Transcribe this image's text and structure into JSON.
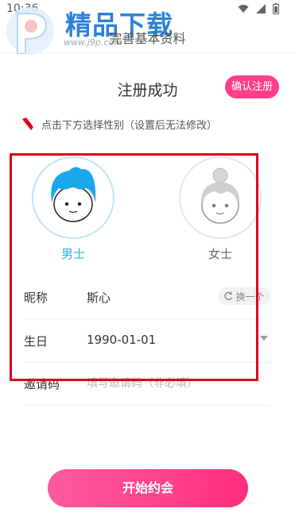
{
  "status_bar": {
    "time": "10:36"
  },
  "watermark": {
    "title": "精品下载",
    "url": "www.j9p.com"
  },
  "header": {
    "title": "完善基本资料"
  },
  "main": {
    "success_title": "注册成功",
    "confirm_button": "确认注册",
    "hint": "点击下方选择性别（设置后无法修改）",
    "genders": {
      "male": "男士",
      "female": "女士"
    },
    "fields": {
      "nickname": {
        "label": "昵称",
        "value": "斯心",
        "swap_label": "换一个"
      },
      "birthday": {
        "label": "生日",
        "value": "1990-01-01"
      },
      "invite": {
        "label": "邀请码",
        "placeholder": "填写邀请码（非必填）"
      }
    },
    "start_button": "开始约会"
  },
  "colors": {
    "accent_pink": "#ff3f88",
    "male_blue": "#29aef0",
    "highlight_red": "#d9001b"
  }
}
